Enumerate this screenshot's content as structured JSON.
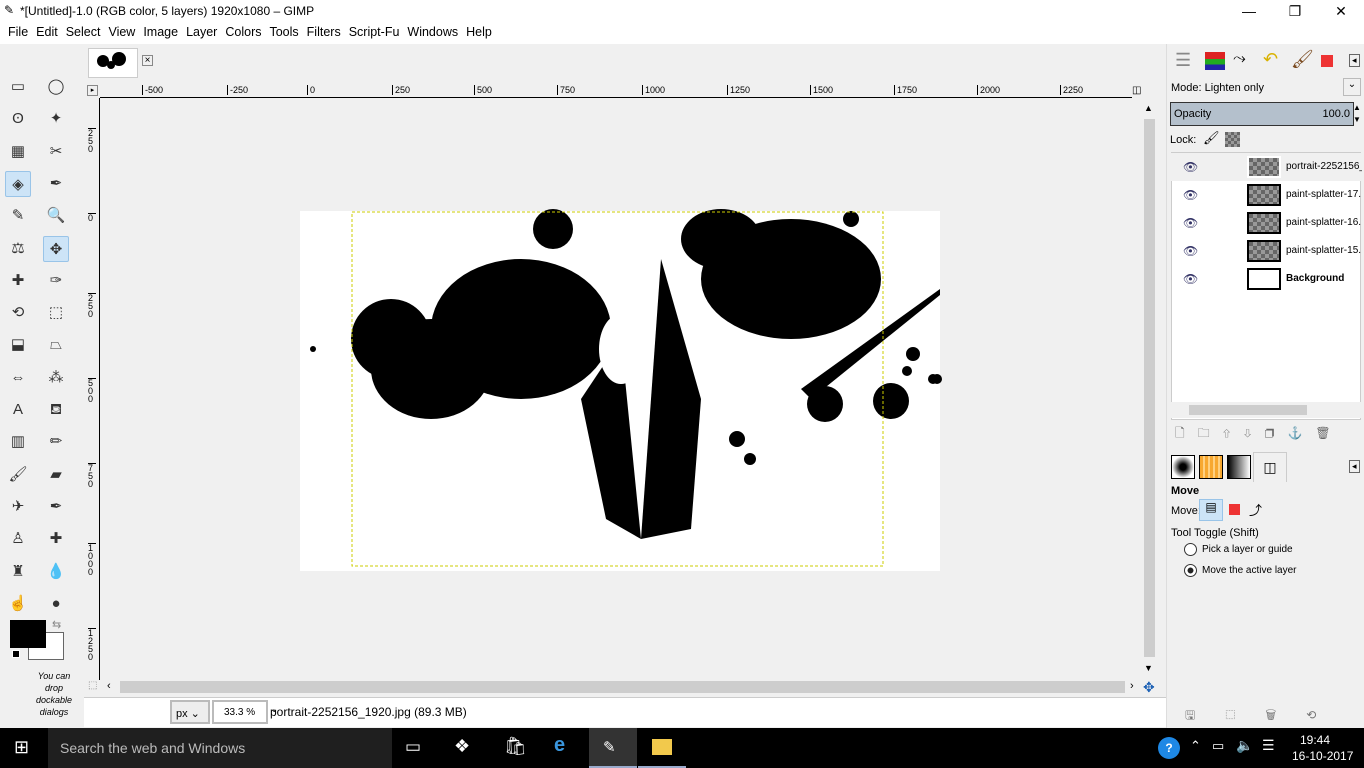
{
  "window": {
    "title": "*[Untitled]-1.0 (RGB color, 5 layers) 1920x1080 – GIMP",
    "minimize": "—",
    "maximize": "❐",
    "close": "✕"
  },
  "menu": [
    "File",
    "Edit",
    "Select",
    "View",
    "Image",
    "Layer",
    "Colors",
    "Tools",
    "Filters",
    "Script-Fu",
    "Windows",
    "Help"
  ],
  "rulers": {
    "horizontal": [
      "-500",
      "-250",
      "0",
      "250",
      "500",
      "750",
      "1000",
      "1250",
      "1500",
      "1750",
      "2000",
      "2250"
    ],
    "vertical": [
      "250",
      "0",
      "250",
      "500",
      "750",
      "1000",
      "1250"
    ]
  },
  "toolbox": {
    "hint": "You can drop dockable dialogs"
  },
  "status": {
    "unit": "px",
    "zoom": "33.3 %",
    "info": "portrait-2252156_1920.jpg (89.3 MB)"
  },
  "layers": {
    "mode": "Mode: Lighten only",
    "opacity_label": "Opacity",
    "opacity": "100.0",
    "lock": "Lock:",
    "items": [
      {
        "name": "portrait-2252156_"
      },
      {
        "name": "paint-splatter-17."
      },
      {
        "name": "paint-splatter-16."
      },
      {
        "name": "paint-splatter-15."
      },
      {
        "name": "Background"
      }
    ]
  },
  "tool_options": {
    "title": "Move",
    "move_label": "Move:",
    "toggle": "Tool Toggle  (Shift)",
    "options": [
      "Pick a layer or guide",
      "Move the active layer"
    ],
    "selected": 1
  },
  "taskbar": {
    "search": "Search the web and Windows",
    "time": "19:44",
    "date": "16-10-2017"
  }
}
